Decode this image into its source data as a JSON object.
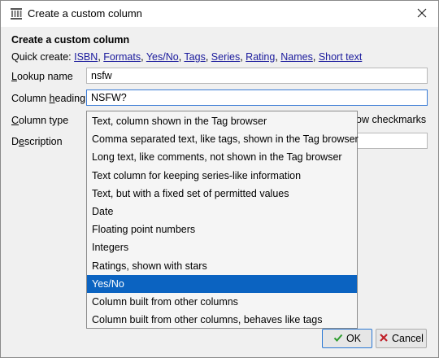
{
  "window": {
    "title": "Create a custom column"
  },
  "dialog": {
    "heading": "Create a custom column",
    "quick_create_label": "Quick create:",
    "quick_links": [
      "ISBN",
      "Formats",
      "Yes/No",
      "Tags",
      "Series",
      "Rating",
      "Names",
      "Short text"
    ]
  },
  "form": {
    "lookup_label_pre": "",
    "lookup_label_u": "L",
    "lookup_label_post": "ookup name",
    "lookup_value": "nsfw",
    "heading_label_pre": "Column ",
    "heading_label_u": "h",
    "heading_label_post": "eading",
    "heading_value": "NSFW?",
    "type_label_pre": "",
    "type_label_u": "C",
    "type_label_post": "olumn type",
    "type_side_text": "ow checkmarks",
    "desc_label_pre": "D",
    "desc_label_u": "e",
    "desc_label_post": "scription",
    "desc_value": ""
  },
  "dropdown": {
    "options": [
      "Text, column shown in the Tag browser",
      "Comma separated text, like tags, shown in the Tag browser",
      "Long text, like comments, not shown in the Tag browser",
      "Text column for keeping series-like information",
      "Text, but with a fixed set of permitted values",
      "Date",
      "Floating point numbers",
      "Integers",
      "Ratings, shown with stars",
      "Yes/No",
      "Column built from other columns",
      "Column built from other columns, behaves like tags"
    ],
    "selected": "Yes/No"
  },
  "buttons": {
    "ok": "OK",
    "cancel": "Cancel"
  },
  "colors": {
    "accent": "#0b63c1",
    "ok_check": "#2e9d2e",
    "cancel_x": "#c0212a",
    "link": "#1a1a9c"
  },
  "icons": {
    "app": "library-icon",
    "close": "close-icon",
    "ok": "checkmark-icon",
    "cancel": "cancel-x-icon"
  }
}
